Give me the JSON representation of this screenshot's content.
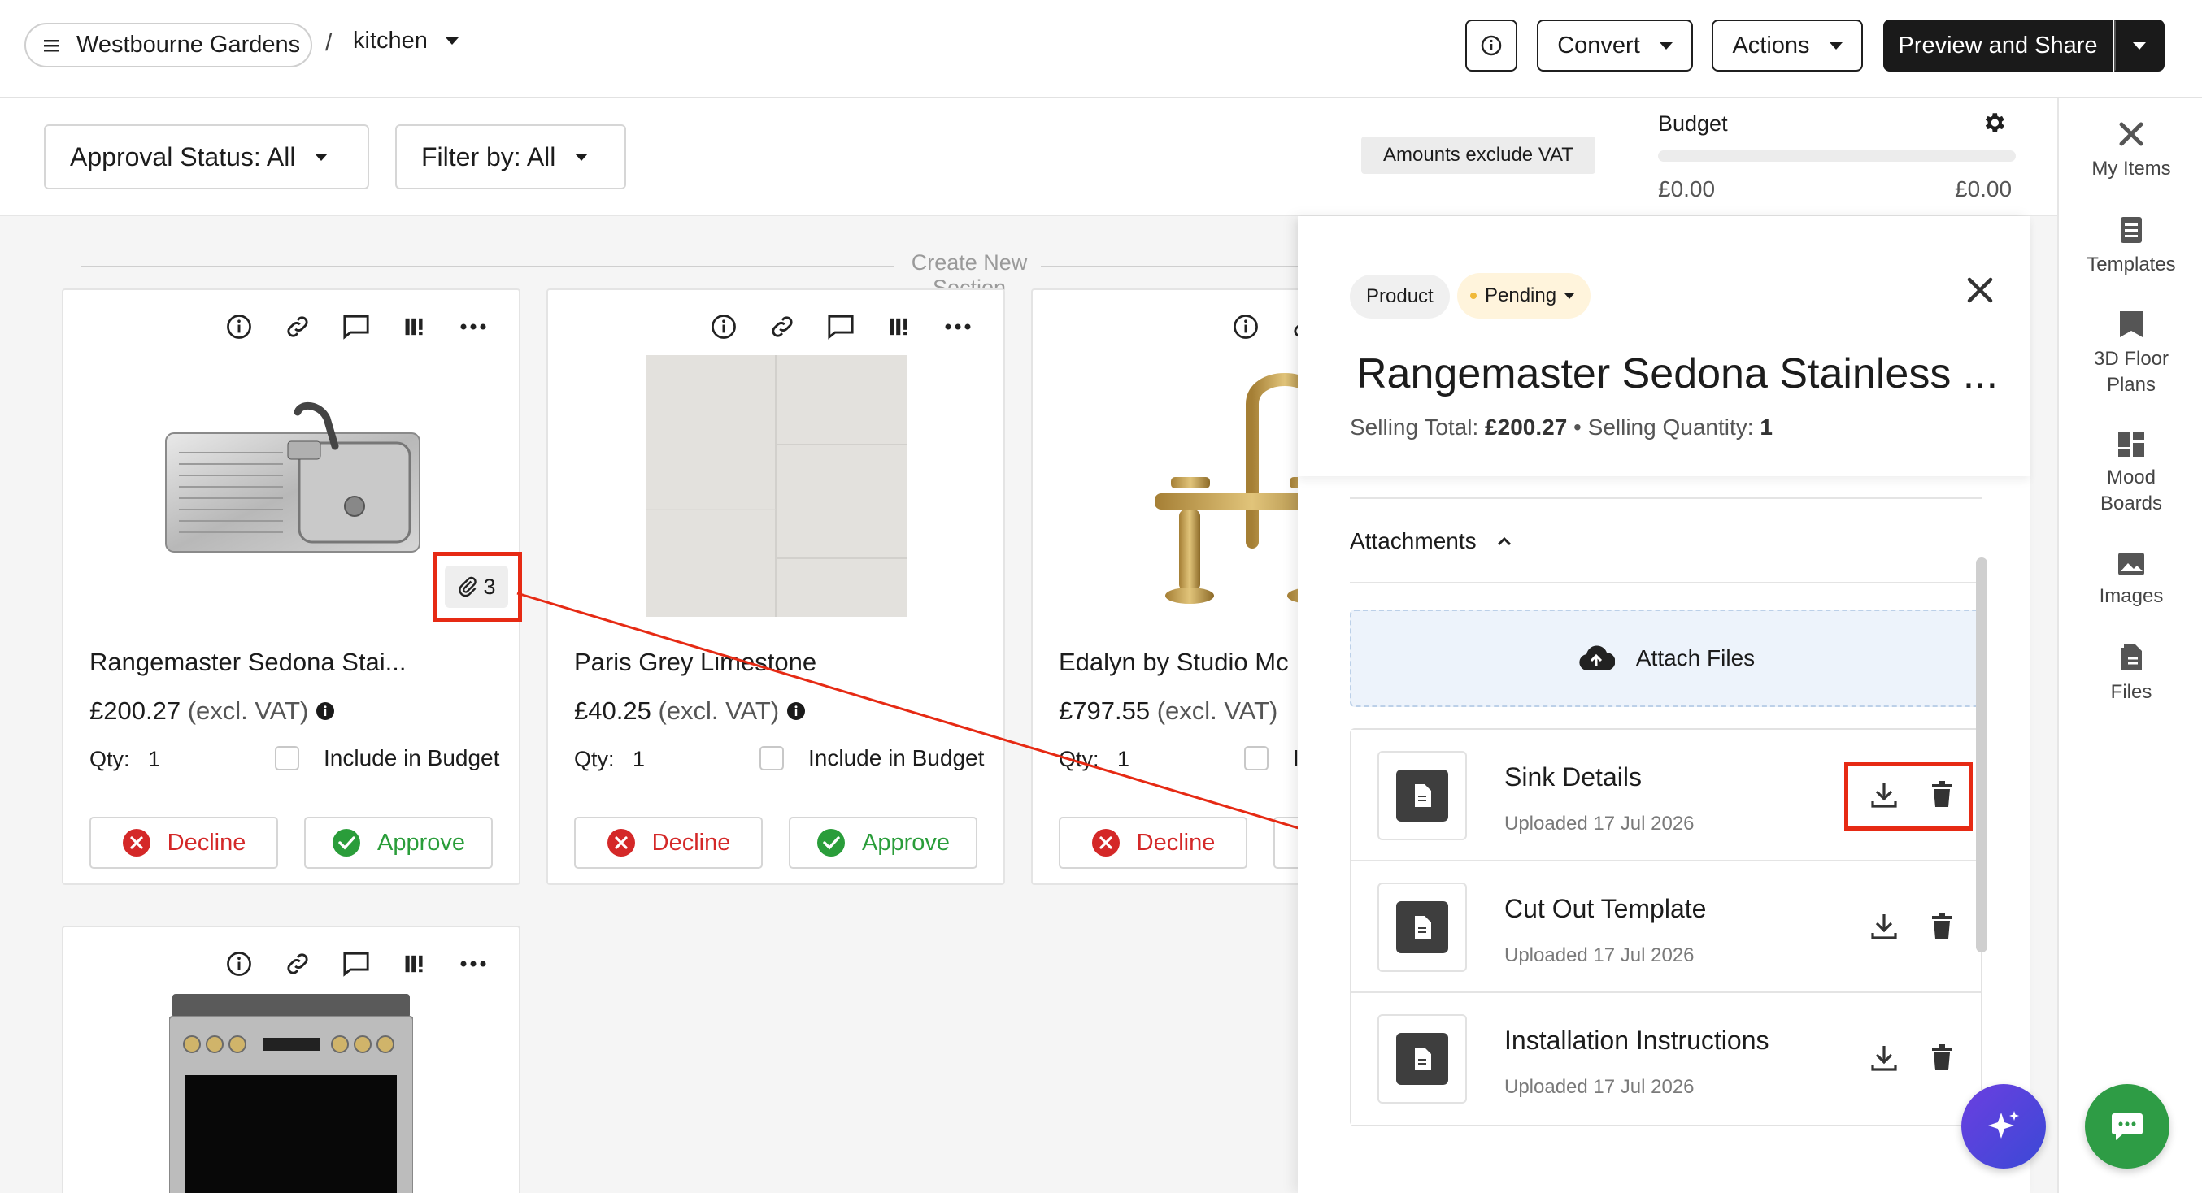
{
  "breadcrumb": {
    "project": "Westbourne Gardens",
    "separator": "/",
    "room": "kitchen"
  },
  "header": {
    "info_icon": "info-icon",
    "convert": "Convert",
    "actions": "Actions",
    "preview": "Preview and Share"
  },
  "filters": {
    "approval": "Approval Status: All",
    "filter": "Filter by: All",
    "vat_note": "Amounts exclude VAT"
  },
  "budget": {
    "label": "Budget",
    "left": "£0.00",
    "right": "£0.00",
    "fill": 0
  },
  "section": {
    "create_label": "Create New Section"
  },
  "cards": [
    {
      "title": "Rangemaster Sedona Stai...",
      "price": "£200.27",
      "excl": "(excl. VAT)",
      "qty_label": "Qty:",
      "qty": "1",
      "include": "Include in Budget",
      "decline": "Decline",
      "approve": "Approve",
      "attachment_count": "3"
    },
    {
      "title": "Paris Grey Limestone",
      "price": "£40.25",
      "excl": "(excl. VAT)",
      "qty_label": "Qty:",
      "qty": "1",
      "include": "Include in Budget",
      "decline": "Decline",
      "approve": "Approve"
    },
    {
      "title": "Edalyn by Studio Mc",
      "price": "£797.55",
      "excl": "(excl. VAT)",
      "qty_label": "Qty:",
      "qty": "1",
      "include": "In",
      "decline": "Decline"
    }
  ],
  "panel": {
    "tag": "Product",
    "status": "Pending",
    "title": "Rangemaster Sedona Stainless ...",
    "selling_total_label": "Selling Total:",
    "selling_total": "£200.27",
    "dot": "•",
    "selling_qty_label": "Selling Quantity:",
    "selling_qty": "1",
    "attachments_label": "Attachments",
    "attach_files": "Attach Files",
    "attachments": [
      {
        "name": "Sink Details",
        "date": "Uploaded 17 Jul 2026"
      },
      {
        "name": "Cut Out Template",
        "date": "Uploaded 17 Jul 2026"
      },
      {
        "name": "Installation Instructions",
        "date": "Uploaded 17 Jul 2026"
      }
    ]
  },
  "sidebar": {
    "items": [
      {
        "label": "My Items",
        "icon": "tools-icon"
      },
      {
        "label": "Templates",
        "icon": "template-icon"
      },
      {
        "label": "3D Floor\nPlans",
        "icon": "floorplan-icon"
      },
      {
        "label": "Mood\nBoards",
        "icon": "moodboard-icon"
      },
      {
        "label": "Images",
        "icon": "image-icon"
      },
      {
        "label": "Files",
        "icon": "files-icon"
      }
    ]
  },
  "colors": {
    "decline": "#d42828",
    "approve": "#2a9d3a",
    "highlight": "#e62a14",
    "ai_button": "#4b3fe0",
    "chat_button": "#2e9c45",
    "pending_bg": "#fff4dc"
  }
}
